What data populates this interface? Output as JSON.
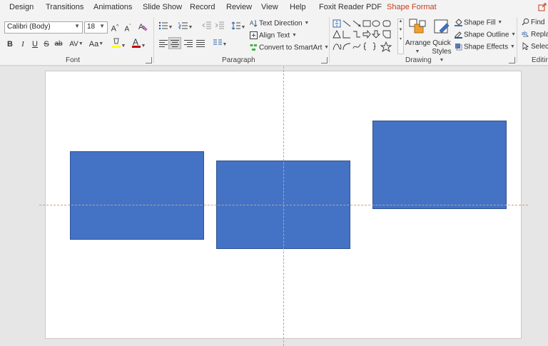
{
  "tabs": {
    "items": [
      {
        "label": "Design"
      },
      {
        "label": "Transitions"
      },
      {
        "label": "Animations"
      },
      {
        "label": "Slide Show"
      },
      {
        "label": "Record"
      },
      {
        "label": "Review"
      },
      {
        "label": "View"
      },
      {
        "label": "Help"
      },
      {
        "label": "Foxit Reader PDF"
      },
      {
        "label": "Shape Format"
      }
    ],
    "active": "Shape Format"
  },
  "font_group": {
    "label": "Font",
    "font_name": "Calibri (Body)",
    "font_size": "18",
    "grow_label": "A",
    "shrink_label": "A",
    "bold_label": "B",
    "italic_label": "I",
    "underline_label": "U",
    "strike_label": "S",
    "shadow_label": "ab",
    "spacing_label": "AV",
    "case_label": "Aa",
    "highlight_label": "ab",
    "color_label": "A",
    "font_color": "#c00000",
    "highlight_color": "#ffff00"
  },
  "paragraph_group": {
    "label": "Paragraph",
    "text_direction_label": "Text Direction",
    "align_text_label": "Align Text",
    "smartart_label": "Convert to SmartArt"
  },
  "drawing_group": {
    "label": "Drawing",
    "arrange_label": "Arrange",
    "quick_styles_line1": "Quick",
    "quick_styles_line2": "Styles",
    "shape_fill_label": "Shape Fill",
    "shape_outline_label": "Shape Outline",
    "shape_effects_label": "Shape Effects"
  },
  "editing_group": {
    "label": "Editin",
    "find_label": "Find",
    "replace_label": "Replac",
    "select_label": "Select"
  },
  "slide": {
    "shape_color": "#4472c4",
    "shape_count": 3
  }
}
